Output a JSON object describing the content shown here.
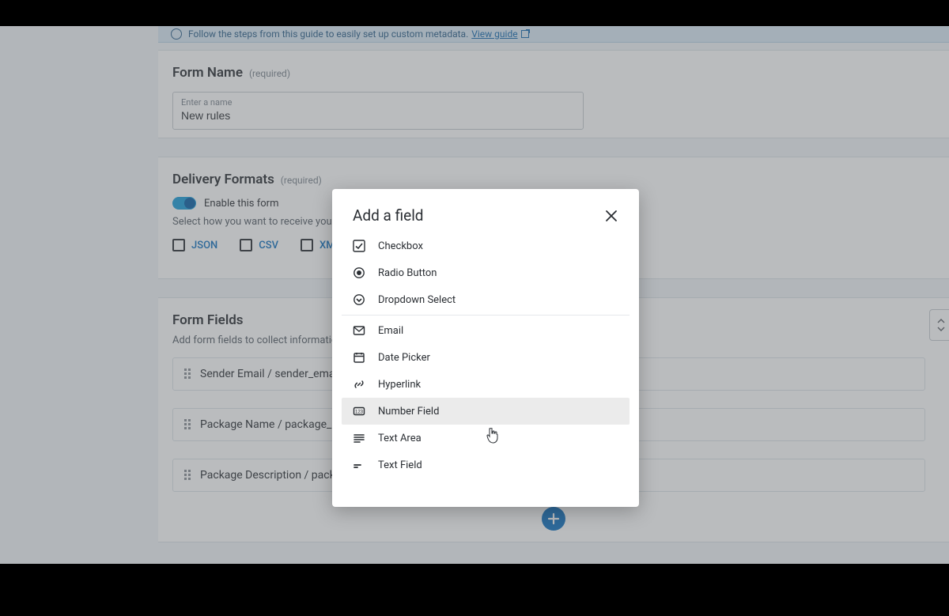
{
  "banner": {
    "text": "Follow the steps from this guide to easily set up custom metadata.",
    "link": "View guide"
  },
  "form_name": {
    "heading": "Form Name",
    "required": "(required)",
    "placeholder": "Enter a name",
    "value": "New rules"
  },
  "delivery": {
    "heading": "Delivery Formats",
    "required": "(required)",
    "toggle_label": "Enable this form",
    "toggle_on": true,
    "subtext": "Select how you want to receive your metadata",
    "formats": [
      "JSON",
      "CSV",
      "XML"
    ]
  },
  "fields_panel": {
    "heading": "Form Fields",
    "subtext": "Add form fields to collect information about your package",
    "rows": [
      "Sender Email / sender_email",
      "Package Name / package_name",
      "Package Description / package_description"
    ]
  },
  "modal": {
    "title": "Add a field",
    "options": [
      {
        "label": "Checkbox",
        "icon": "checkbox-icon"
      },
      {
        "label": "Radio Button",
        "icon": "radio-icon"
      },
      {
        "label": "Dropdown Select",
        "icon": "dropdown-icon"
      },
      {
        "label": "Email",
        "icon": "mail-icon"
      },
      {
        "label": "Date Picker",
        "icon": "calendar-icon"
      },
      {
        "label": "Hyperlink",
        "icon": "link-icon"
      },
      {
        "label": "Number Field",
        "icon": "number-icon",
        "hover": true
      },
      {
        "label": "Text Area",
        "icon": "textarea-icon"
      },
      {
        "label": "Text Field",
        "icon": "textfield-icon"
      }
    ],
    "separator_after_index": 2
  }
}
